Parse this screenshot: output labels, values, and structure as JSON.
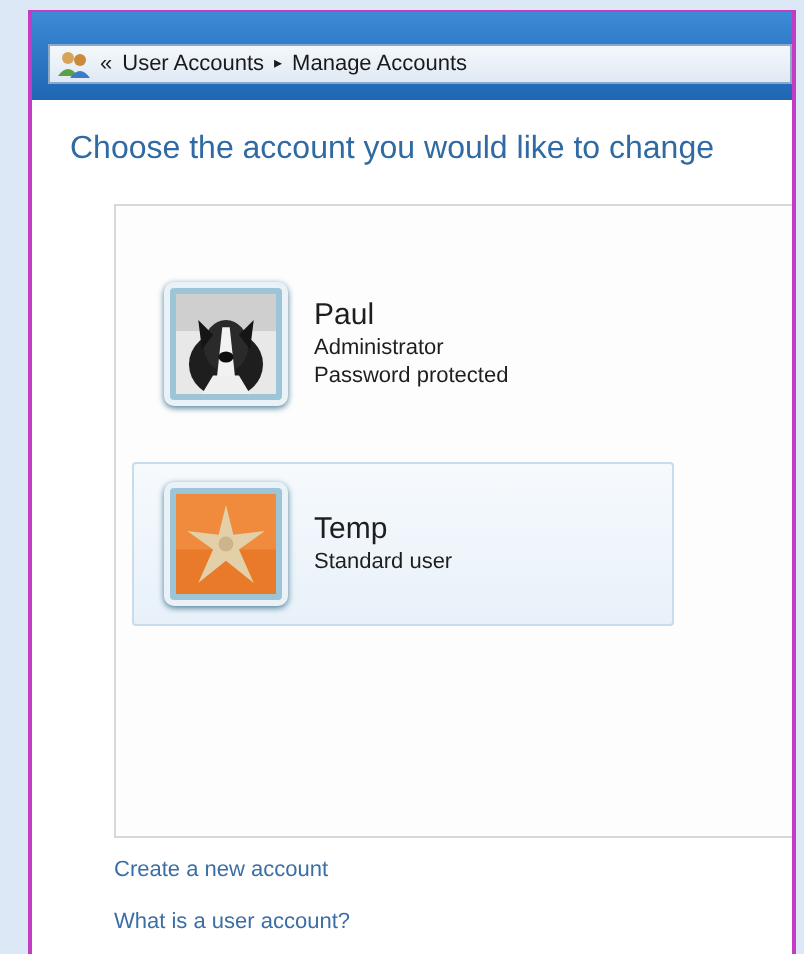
{
  "breadcrumb": {
    "overflow": "«",
    "items": [
      "User Accounts",
      "Manage Accounts"
    ],
    "separator": "▸"
  },
  "heading": "Choose the account you would like to change",
  "accounts": [
    {
      "name": "Paul",
      "details": [
        "Administrator",
        "Password protected"
      ],
      "selected": false
    },
    {
      "name": "Temp",
      "details": [
        "Standard user"
      ],
      "selected": true
    }
  ],
  "links": [
    "Create a new account",
    "What is a user account?"
  ]
}
